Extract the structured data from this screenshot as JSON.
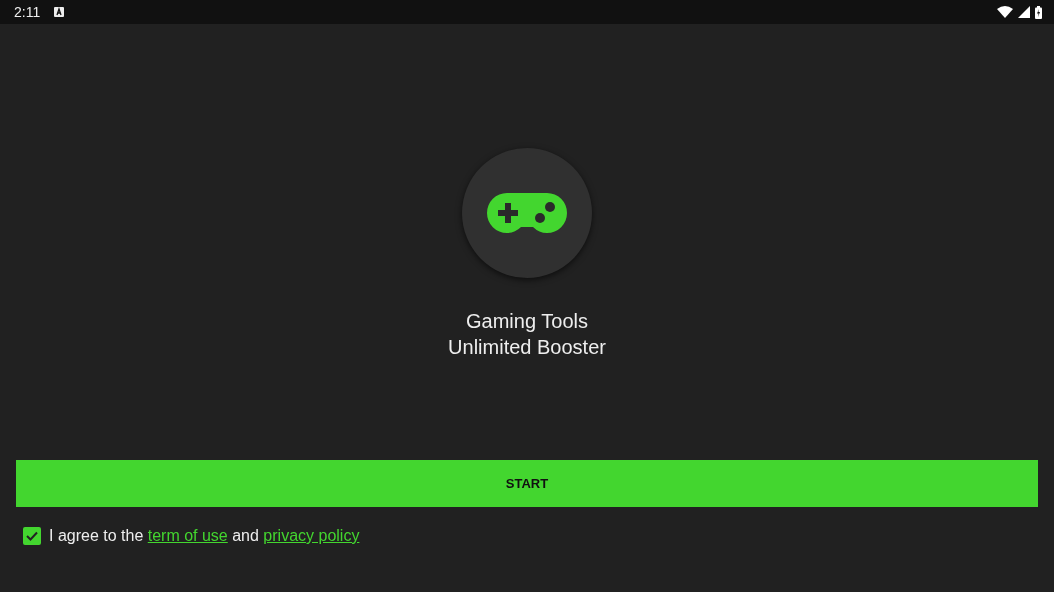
{
  "status_bar": {
    "time": "2:11"
  },
  "app": {
    "title_lines": [
      "Gaming Tools",
      "Unlimited Booster"
    ]
  },
  "start_button": {
    "label": "START"
  },
  "agreement": {
    "checked": true,
    "segments": [
      {
        "kind": "text",
        "text": "I agree to the "
      },
      {
        "kind": "link",
        "text": "term of use"
      },
      {
        "kind": "text",
        "text": " and "
      },
      {
        "kind": "link",
        "text": "privacy policy"
      }
    ]
  }
}
